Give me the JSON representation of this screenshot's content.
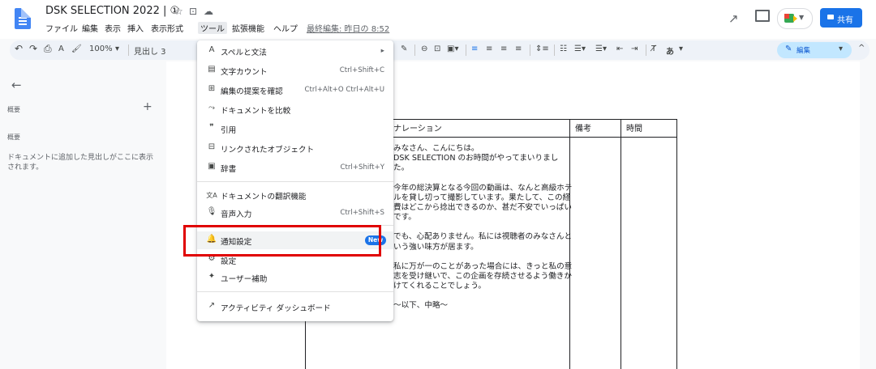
{
  "header": {
    "title": "DSK SELECTION 2022 | ①",
    "star_icon": "☆",
    "folder_icon": "⊡",
    "cloud_icon": "☁",
    "menus": [
      "ファイル",
      "編集",
      "表示",
      "挿入",
      "表示形式",
      "ツール",
      "拡張機能",
      "ヘルプ"
    ],
    "last_edit": "最終編集: 昨日の 8:52",
    "share_label": "共有",
    "trend_icon": "↗"
  },
  "toolbar": {
    "undo": "↶",
    "redo": "↷",
    "print": "⎙",
    "spell": "A",
    "paint": "🖌",
    "zoom": "100%",
    "style": "見出し 3",
    "text_style_a": "あ",
    "edit_mode": "編集"
  },
  "outline": {
    "back_icon": "←",
    "label": "概要",
    "add_icon": "+",
    "sub_label": "概要",
    "help": "ドキュメントに追加した見出しがここに表示されます。"
  },
  "table": {
    "headers": [
      "ナレーション",
      "備考",
      "時間"
    ],
    "narration": [
      "みなさん、こんにちは。\nDSK SELECTION のお時間がやってまいりました。",
      "今年の総決算となる今回の動画は、なんと高級ホテルを貸し切って撮影しています。果たして、この経費はどこから捻出できるのか、甚だ不安でいっぱいです。",
      "でも、心配ありません。私には視聴者のみなさんという強い味方が居ます。",
      "私に万が一のことがあった場合には、きっと私の意志を受け継いで、この企画を存続させるよう働きかけてくれることでしょう。",
      "〜以下、中略〜"
    ]
  },
  "menu": {
    "items": [
      {
        "icon": "A",
        "label": "スペルと文法",
        "shortcut": "▸"
      },
      {
        "icon": "▤",
        "label": "文字カウント",
        "shortcut": "Ctrl+Shift+C"
      },
      {
        "icon": "⊞",
        "label": "編集の提案を確認",
        "shortcut": "Ctrl+Alt+O Ctrl+Alt+U"
      },
      {
        "icon": "⤳",
        "label": "ドキュメントを比較",
        "shortcut": ""
      },
      {
        "icon": "❞",
        "label": "引用",
        "shortcut": ""
      },
      {
        "icon": "⊟",
        "label": "リンクされたオブジェクト",
        "shortcut": ""
      },
      {
        "icon": "▣",
        "label": "辞書",
        "shortcut": "Ctrl+Shift+Y"
      },
      {
        "icon": "文A",
        "label": "ドキュメントの翻訳機能",
        "shortcut": ""
      },
      {
        "icon": "🎙",
        "label": "音声入力",
        "shortcut": "Ctrl+Shift+S"
      },
      {
        "icon": "🔔",
        "label": "通知設定",
        "shortcut": ""
      },
      {
        "icon": "⚙",
        "label": "設定",
        "shortcut": ""
      },
      {
        "icon": "✦",
        "label": "ユーザー補助",
        "shortcut": ""
      },
      {
        "icon": "↗",
        "label": "アクティビティ ダッシュボード",
        "shortcut": ""
      }
    ],
    "new_badge": "New"
  },
  "colors": {
    "accent": "#1a73e8",
    "highlight": "#e00000"
  }
}
